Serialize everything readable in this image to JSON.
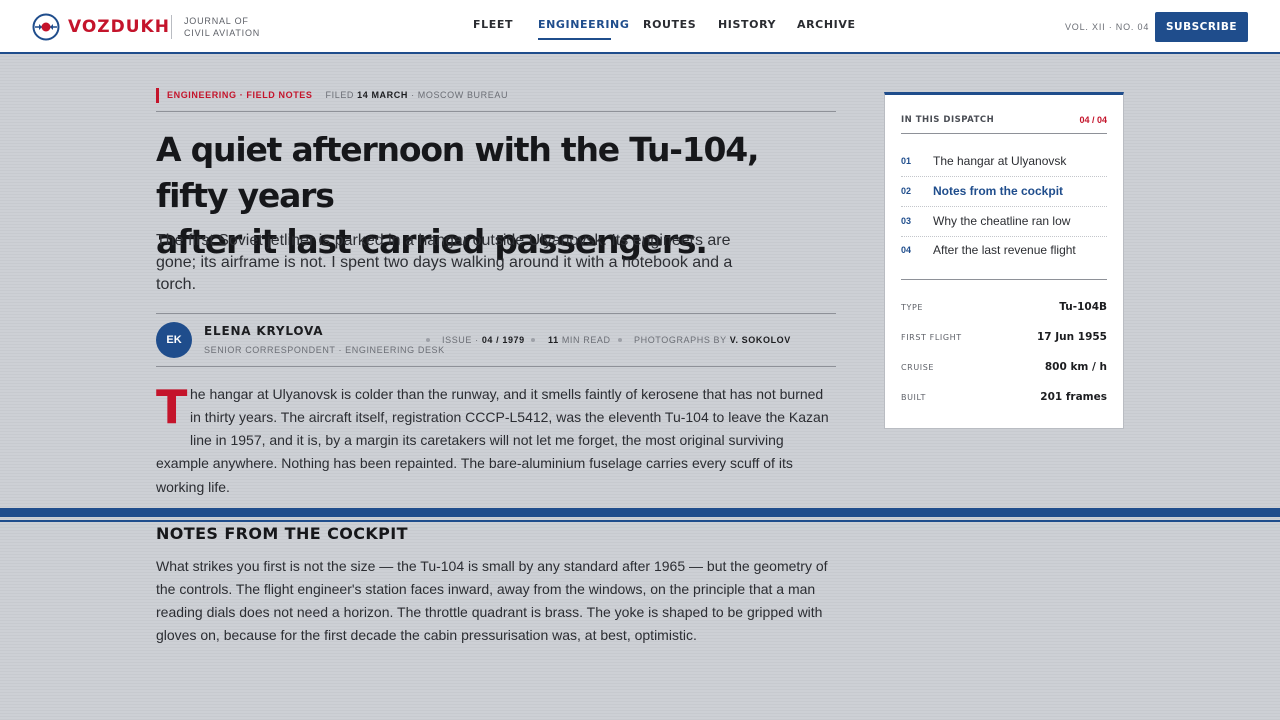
{
  "brand": {
    "name": "VOZDUKH",
    "tagline_line1": "JOURNAL OF",
    "tagline_line2": "CIVIL AVIATION",
    "accent_color": "#c4142b",
    "primary_color": "#1f4d8c"
  },
  "nav": {
    "items": [
      {
        "label": "FLEET",
        "active": false
      },
      {
        "label": "ENGINEERING",
        "active": true
      },
      {
        "label": "ROUTES",
        "active": false
      },
      {
        "label": "HISTORY",
        "active": false
      },
      {
        "label": "ARCHIVE",
        "active": false
      }
    ]
  },
  "header": {
    "volume": "VOL. XII · NO. 04",
    "subscribe_label": "SUBSCRIBE"
  },
  "article": {
    "kicker_section": "ENGINEERING · FIELD NOTES",
    "filed_prefix": "FILED",
    "filed_date": "14 MARCH",
    "filed_suffix": "· MOSCOW BUREAU",
    "headline_line1": "A quiet afternoon with the Tu-104, fifty years",
    "headline_line2": "after it last carried passengers.",
    "dek_line1": "The first Soviet jetliner is parked in a hangar outside Ulyanovsk. Its engineers are",
    "dek_line2": "gone; its airframe is not. I spent two days walking around it with a notebook and a",
    "dek_line3": "torch.",
    "author": {
      "initials": "EK",
      "name": "ELENA KRYLOVA",
      "role": "SENIOR CORRESPONDENT · ENGINEERING DESK"
    },
    "meta": {
      "issue_label": "ISSUE ·",
      "issue_value": "04 / 1979",
      "read_value": "11",
      "read_label": "MIN READ",
      "photos_label": "PHOTOGRAPHS BY",
      "photos_value": "V. SOKOLOV"
    },
    "dropcap": "T",
    "lead_lines": [
      "he hangar at Ulyanovsk is colder than the runway, and it smells faintly of kerosene that has not burned",
      "in thirty years. The aircraft itself, registration CCCP-L5412, was the eleventh Tu-104 to leave the Kazan",
      "line in 1957, and it is, by a margin its caretakers will not let me forget, the most original surviving",
      "example anywhere. Nothing has been repainted. The bare-aluminium fuselage carries every scuff of its",
      "working life."
    ],
    "subhead": "NOTES FROM THE COCKPIT",
    "section_lines": [
      "What strikes you first is not the size — the Tu-104 is small by any standard after 1965 — but the geometry of",
      "the controls. The flight engineer's station faces inward, away from the windows, on the principle that a man",
      "reading dials does not need a horizon. The throttle quadrant is brass. The yoke is shaped to be gripped with",
      "gloves on, because for the first decade the cabin pressurisation was, at best, optimistic."
    ]
  },
  "sidebar": {
    "label": "IN THIS DISPATCH",
    "count": "04 / 04",
    "toc": [
      {
        "num": "01",
        "title": "The hangar at Ulyanovsk",
        "current": false
      },
      {
        "num": "02",
        "title": "Notes from the cockpit",
        "current": true
      },
      {
        "num": "03",
        "title": "Why the cheatline ran low",
        "current": false
      },
      {
        "num": "04",
        "title": "After the last revenue flight",
        "current": false
      }
    ],
    "specs": [
      {
        "label": "TYPE",
        "value": "Tu-104B"
      },
      {
        "label": "FIRST FLIGHT",
        "value": "17 Jun 1955"
      },
      {
        "label": "CRUISE",
        "value": "800 km / h"
      },
      {
        "label": "BUILT",
        "value": "201 frames"
      }
    ]
  }
}
